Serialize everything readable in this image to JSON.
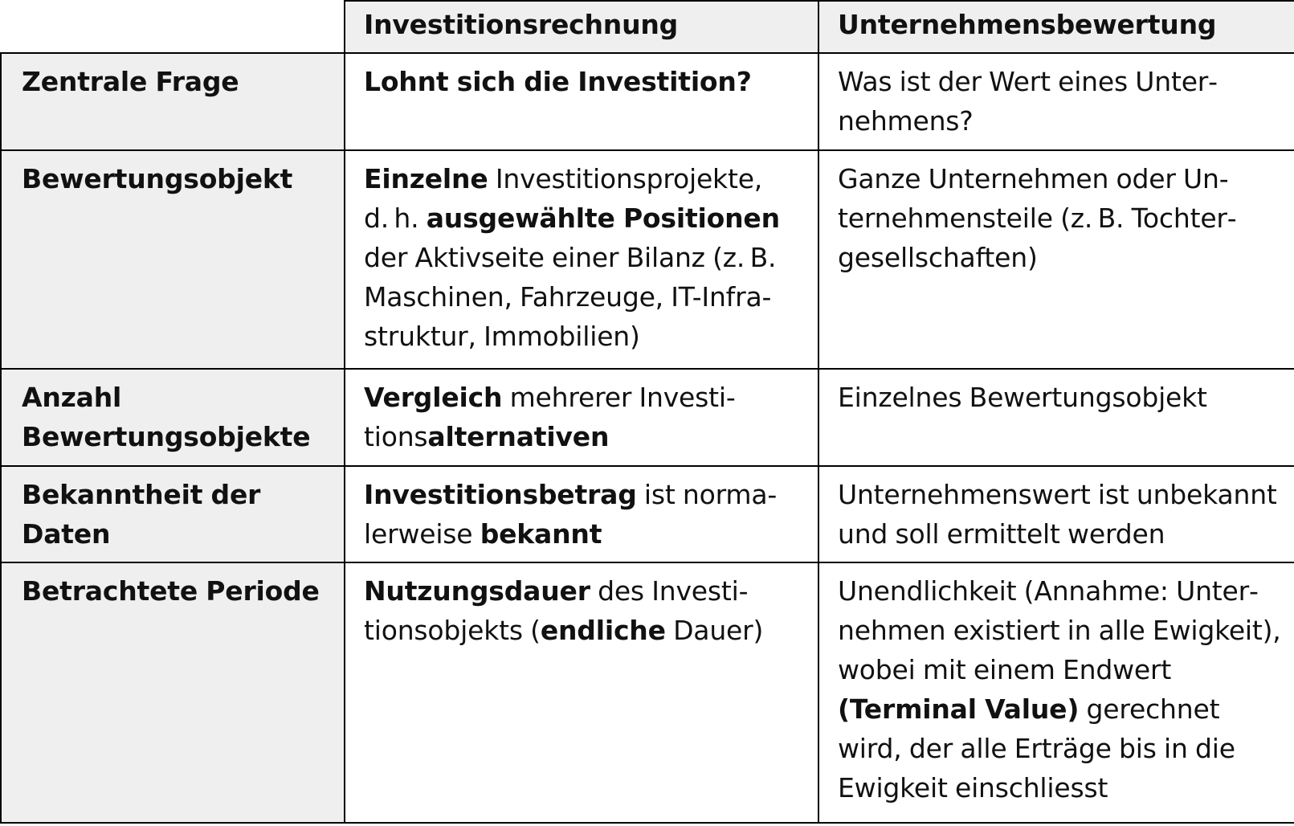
{
  "table": {
    "header": [
      "",
      "Investitionsrechnung",
      "Unternehmensbewertung"
    ],
    "rows": [
      {
        "label": "Zentrale Frage",
        "investition": [
          {
            "text": "Lohnt sich die Investition?",
            "bold": true
          }
        ],
        "unternehmen": [
          {
            "text": "Was ist der Wert eines Unter­nehmens?",
            "bold": false
          }
        ]
      },
      {
        "label": "Bewertungsobjekt",
        "investition": [
          {
            "text": "Einzelne",
            "bold": true
          },
          {
            "text": " Investitionsprojekte, d. h. ",
            "bold": false
          },
          {
            "text": "ausgewählte Positionen",
            "bold": true
          },
          {
            "text": " der Aktivseite einer Bilanz (z. B. Maschinen, Fahrzeuge, IT-Infra­struktur, Immobilien)",
            "bold": false
          }
        ],
        "unternehmen": [
          {
            "text": "Ganze Unternehmen oder Un­ternehmensteile (z. B. Tochter­gesellschaften)",
            "bold": false
          }
        ]
      },
      {
        "label": "Anzahl Bewertungsobjekte",
        "investition": [
          {
            "text": "Vergleich",
            "bold": true
          },
          {
            "text": " mehrerer Investi­tions",
            "bold": false
          },
          {
            "text": "alternativen",
            "bold": true
          }
        ],
        "unternehmen": [
          {
            "text": "Einzelnes Bewertungsobjekt",
            "bold": false
          }
        ]
      },
      {
        "label": "Bekanntheit der Daten",
        "investition": [
          {
            "text": "Investitionsbetrag",
            "bold": true
          },
          {
            "text": " ist norma­lerweise ",
            "bold": false
          },
          {
            "text": "bekannt",
            "bold": true
          }
        ],
        "unternehmen": [
          {
            "text": "Unternehmenswert ist unbe­kannt und soll ermittelt werden",
            "bold": false
          }
        ]
      },
      {
        "label": "Betrachtete Periode",
        "investition": [
          {
            "text": "Nutzungsdauer",
            "bold": true
          },
          {
            "text": " des Investi­tionsobjekts (",
            "bold": false
          },
          {
            "text": "endliche",
            "bold": true
          },
          {
            "text": " Dauer)",
            "bold": false
          }
        ],
        "unternehmen": [
          {
            "text": "Unendlichkeit (Annahme: Unter­nehmen existiert in alle Ewig­keit), wobei mit einem Endwert ",
            "bold": false
          },
          {
            "text": "(Terminal Value)",
            "bold": true
          },
          {
            "text": " gerechnet wird, der alle Erträge bis in die Ewigkeit einschliesst",
            "bold": false
          }
        ]
      }
    ]
  }
}
